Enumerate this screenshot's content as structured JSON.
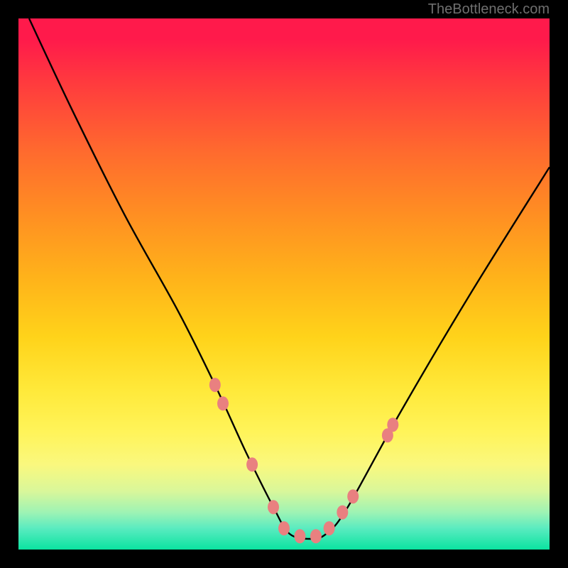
{
  "watermark": "TheBottleneck.com",
  "chart_data": {
    "type": "line",
    "title": "",
    "xlabel": "",
    "ylabel": "",
    "xlim": [
      0,
      100
    ],
    "ylim": [
      0,
      100
    ],
    "grid": false,
    "series": [
      {
        "name": "bottleneck-curve",
        "x": [
          2,
          10,
          20,
          30,
          37,
          43,
          48,
          51,
          55,
          58,
          62,
          72,
          85,
          100
        ],
        "values": [
          100,
          83,
          63,
          45,
          31,
          18,
          8,
          3,
          2,
          3,
          8,
          26,
          48,
          72
        ]
      }
    ],
    "markers": [
      {
        "x": 37.0,
        "y": 31.0
      },
      {
        "x": 38.5,
        "y": 27.5
      },
      {
        "x": 44.0,
        "y": 16.0
      },
      {
        "x": 48.0,
        "y": 8.0
      },
      {
        "x": 50.0,
        "y": 4.0
      },
      {
        "x": 53.0,
        "y": 2.5
      },
      {
        "x": 56.0,
        "y": 2.5
      },
      {
        "x": 58.5,
        "y": 4.0
      },
      {
        "x": 61.0,
        "y": 7.0
      },
      {
        "x": 63.0,
        "y": 10.0
      },
      {
        "x": 69.5,
        "y": 21.5
      },
      {
        "x": 70.5,
        "y": 23.5
      }
    ]
  },
  "colors": {
    "frame": "#000000",
    "curve": "#000000",
    "marker": "#e98080",
    "gradient_top": "#ff1a4b",
    "gradient_bottom": "#0be3a0"
  }
}
